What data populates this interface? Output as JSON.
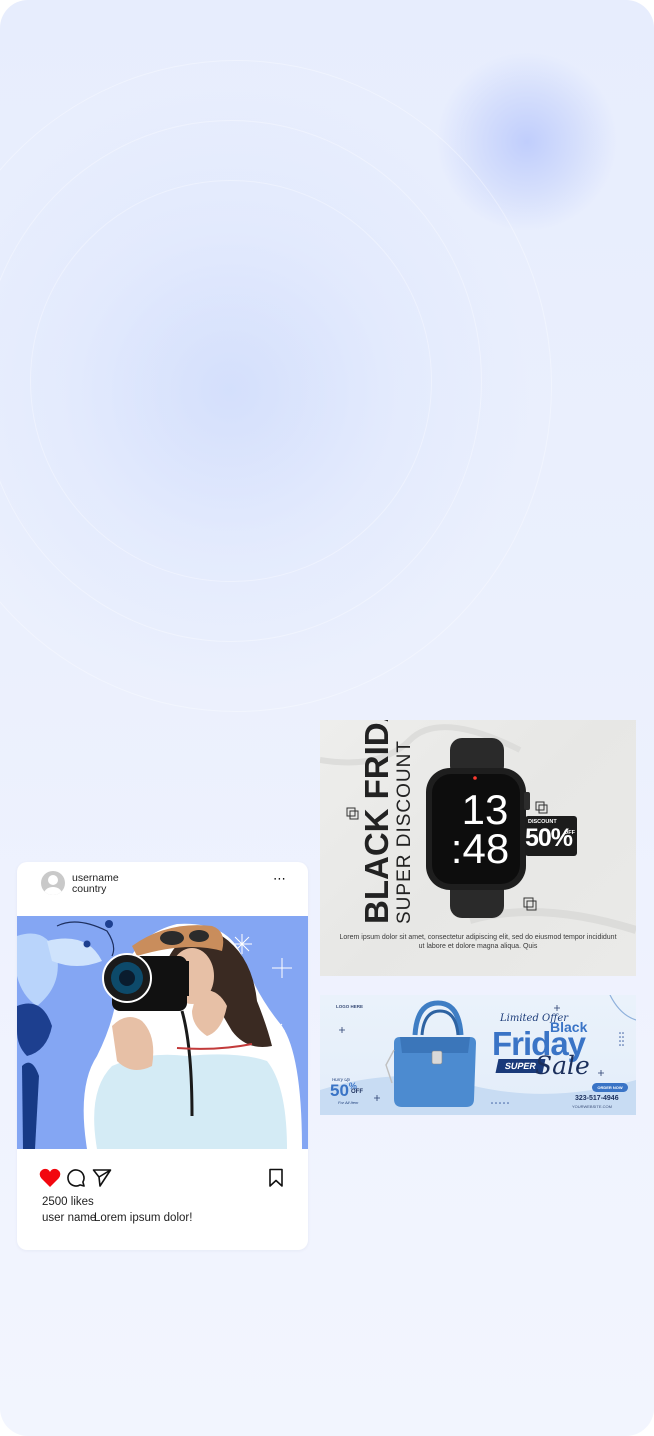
{
  "post": {
    "username": "username",
    "location": "country",
    "more_icon": "⋯",
    "likes": "2500 likes",
    "caption_user": "user name",
    "caption_text": "Lorem ipsum dolor!",
    "liked": true,
    "colors": {
      "like": "#f2070f",
      "photo_bg": "#84a6f3"
    }
  },
  "ads": {
    "watch": {
      "headline": "BLACK FRIDAY",
      "subheadline": "SUPER DISCOUNT",
      "time_hours": "13",
      "time_minutes": ":48",
      "discount_label": "DISCOUNT",
      "discount_value": "50%",
      "discount_off": "OFF",
      "body": "Lorem ipsum dolor sit amet, consectetur adipiscing elit, sed do eiusmod tempor incididunt ut labore et dolore magna aliqua. Quis"
    },
    "bag": {
      "logo": "LOGO HERE",
      "limited": "Limited Offer",
      "black": "Black",
      "friday": "Friday",
      "super": "SUPER",
      "sale": "Sale",
      "order_button": "ORDER NOW",
      "phone": "323-517-4946",
      "website": "YOURWEBSITE.COM",
      "up_to": "Hurry Up",
      "percent": "50",
      "percent_sign": "%",
      "off": "OFF",
      "for_all": "For All Item"
    }
  }
}
